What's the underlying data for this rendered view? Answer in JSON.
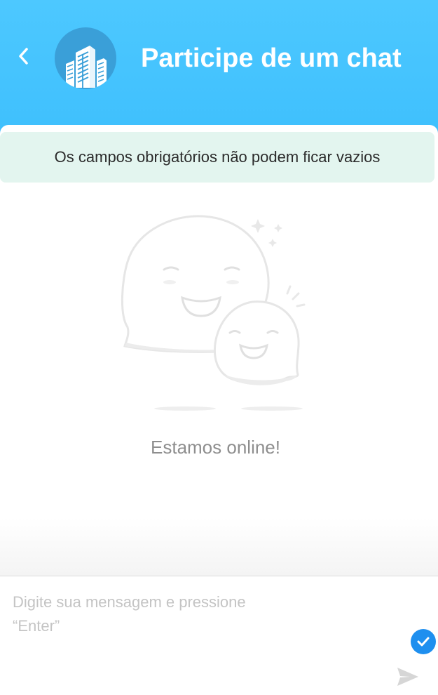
{
  "header": {
    "title": "Participe de um chat",
    "back_icon": "chevron-left-icon",
    "avatar_icon": "building-icon"
  },
  "notice": {
    "text": "Os campos obrigatórios não podem ficar vazios"
  },
  "empty_state": {
    "illustration_icon": "chat-bubbles-icon",
    "text": "Estamos online!"
  },
  "composer": {
    "placeholder": "Digite sua mensagem e pressione “Enter”",
    "value": "",
    "status_icon": "check-circle-icon",
    "send_icon": "send-icon"
  },
  "colors": {
    "header_bg": "#4dc8ff",
    "notice_bg": "#e3f5ef",
    "accent": "#1e8fef"
  }
}
